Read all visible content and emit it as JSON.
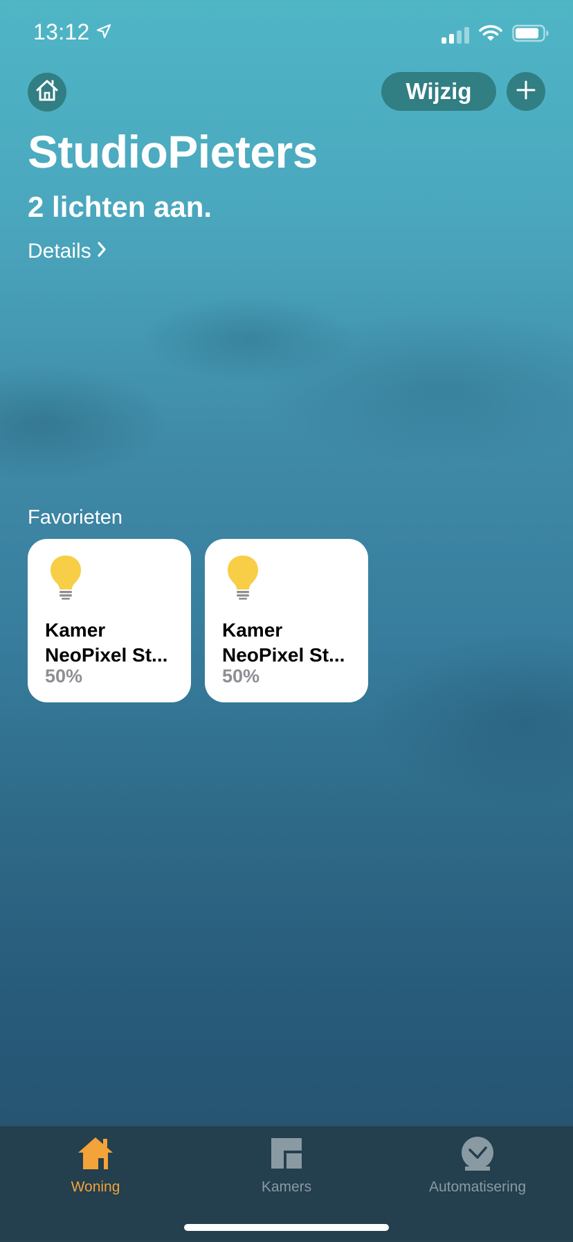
{
  "status_bar": {
    "time": "13:12"
  },
  "header": {
    "edit_label": "Wijzig"
  },
  "home": {
    "name": "StudioPieters",
    "status": "2 lichten aan.",
    "details_label": "Details"
  },
  "favorites": {
    "title": "Favorieten",
    "tiles": [
      {
        "line1": "Kamer",
        "line2": "NeoPixel St...",
        "value": "50%",
        "icon": "lightbulb-icon",
        "state": "on"
      },
      {
        "line1": "Kamer",
        "line2": "NeoPixel St...",
        "value": "50%",
        "icon": "lightbulb-icon",
        "state": "on"
      }
    ]
  },
  "tab_bar": {
    "tabs": [
      {
        "label": "Woning",
        "icon": "house-icon",
        "selected": true
      },
      {
        "label": "Kamers",
        "icon": "rooms-icon",
        "selected": false
      },
      {
        "label": "Automatisering",
        "icon": "clock-check-icon",
        "selected": false
      }
    ]
  },
  "colors": {
    "accent": "#F2A33A",
    "bulb_on": "#F7CE46",
    "tile_background": "#FFFFFF",
    "tile_secondary_text": "#8E8E93",
    "tab_inactive": "#8A9AA3"
  }
}
